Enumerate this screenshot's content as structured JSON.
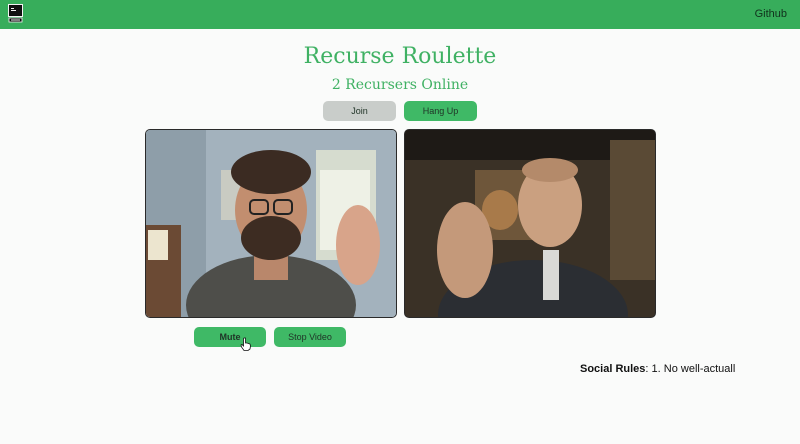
{
  "header": {
    "logo_icon": "computer-terminal-icon",
    "github_label": "Github",
    "bar_color": "#37ad5b"
  },
  "main": {
    "title": "Recurse Roulette",
    "subtitle": "2 Recursers Online",
    "accent_color": "#3fb163"
  },
  "controls": {
    "join_label": "Join",
    "hangup_label": "Hang Up"
  },
  "video": {
    "mute_label": "Mute",
    "stop_video_label": "Stop Video"
  },
  "footer": {
    "social_rules_label": "Social Rules",
    "social_rules_text": ": 1. No well-actuall"
  }
}
